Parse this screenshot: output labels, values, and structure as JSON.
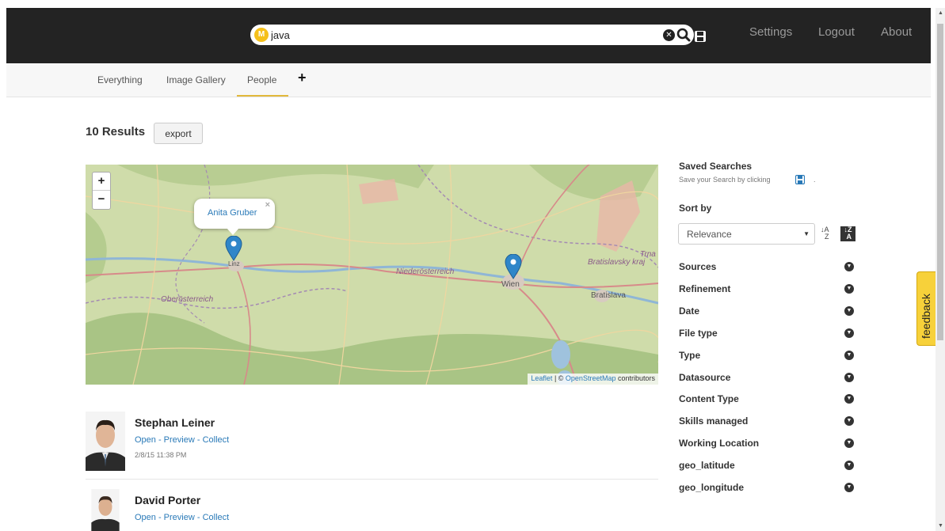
{
  "header": {
    "search_value": "java",
    "logo_letter": "M",
    "clear_icon": "times-circle-icon",
    "search_icon": "magnifier-icon",
    "save_icon": "floppy-disk-icon",
    "links": {
      "settings": "Settings",
      "logout": "Logout",
      "about": "About"
    }
  },
  "tabs": {
    "everything": "Everything",
    "image_gallery": "Image Gallery",
    "people": "People",
    "active": "People",
    "add": "+"
  },
  "results": {
    "count_label": "10 Results",
    "export_label": "export"
  },
  "map": {
    "zoom_in": "+",
    "zoom_out": "−",
    "popup_name": "Anita Gruber",
    "popup_close": "×",
    "places": {
      "linz": "Linz",
      "wien": "Wien",
      "bratislava": "Bratislava",
      "niederoesterreich": "Niederösterreich",
      "oberoesterreich": "Oberösterreich",
      "bratislavsky": "Bratislavsky kraj",
      "trna": "Trna"
    },
    "attribution": {
      "leaflet": "Leaflet",
      "sep": " | © ",
      "osm": "OpenStreetMap",
      "contrib": " contributors"
    }
  },
  "people": [
    {
      "name": "Stephan Leiner",
      "actions": "Open - Preview - Collect",
      "date": "2/8/15 11:38 PM"
    },
    {
      "name": "David Porter",
      "actions": "Open - Preview - Collect",
      "date": ""
    }
  ],
  "sidebar": {
    "saved_title": "Saved Searches",
    "saved_hint": "Save your Search by clicking",
    "saved_hint_end": ".",
    "sort_title": "Sort by",
    "sort_value": "Relevance",
    "facets": [
      "Sources",
      "Refinement",
      "Date",
      "File type",
      "Type",
      "Datasource",
      "Content Type",
      "Skills managed",
      "Working Location",
      "geo_latitude",
      "geo_longitude"
    ]
  },
  "feedback_label": "feedback",
  "colors": {
    "topbar": "#232323",
    "accent": "#e2b93b",
    "link": "#2a7ab8",
    "feedback": "#f7d13a"
  }
}
